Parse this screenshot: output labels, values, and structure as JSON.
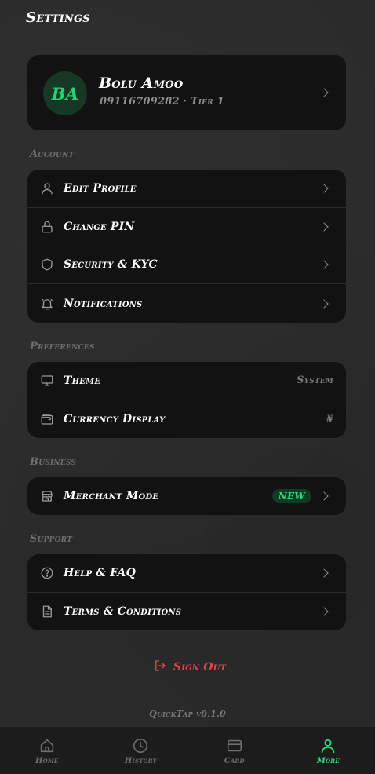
{
  "header": {
    "title": "Settings"
  },
  "profile": {
    "initials": "BA",
    "name": "Bolu Amoo",
    "subtitle": "09116709282 · Tier 1"
  },
  "sections": {
    "account": {
      "label": "Account",
      "items": [
        {
          "label": "Edit Profile",
          "icon": "user-icon"
        },
        {
          "label": "Change PIN",
          "icon": "lock-icon"
        },
        {
          "label": "Security & KYC",
          "icon": "shield-icon"
        },
        {
          "label": "Notifications",
          "icon": "bell-icon"
        }
      ]
    },
    "preferences": {
      "label": "Preferences",
      "items": [
        {
          "label": "Theme",
          "icon": "monitor-icon",
          "value": "System"
        },
        {
          "label": "Currency Display",
          "icon": "wallet-icon",
          "value": "₦"
        }
      ]
    },
    "business": {
      "label": "Business",
      "items": [
        {
          "label": "Merchant Mode",
          "icon": "store-icon",
          "badge": "NEW"
        }
      ]
    },
    "support": {
      "label": "Support",
      "items": [
        {
          "label": "Help & FAQ",
          "icon": "help-circle-icon"
        },
        {
          "label": "Terms & Conditions",
          "icon": "document-icon"
        }
      ]
    }
  },
  "signout": {
    "label": "Sign Out"
  },
  "version": "QuickTap v0.1.0",
  "tabs": [
    {
      "label": "Home",
      "icon": "home-icon",
      "active": false
    },
    {
      "label": "History",
      "icon": "clock-icon",
      "active": false
    },
    {
      "label": "Card",
      "icon": "card-icon",
      "active": false
    },
    {
      "label": "More",
      "icon": "person-icon",
      "active": true
    }
  ],
  "colors": {
    "accent": "#2bdc7f",
    "danger": "#e04848",
    "card": "#121212",
    "background": "#2b2b2b"
  }
}
